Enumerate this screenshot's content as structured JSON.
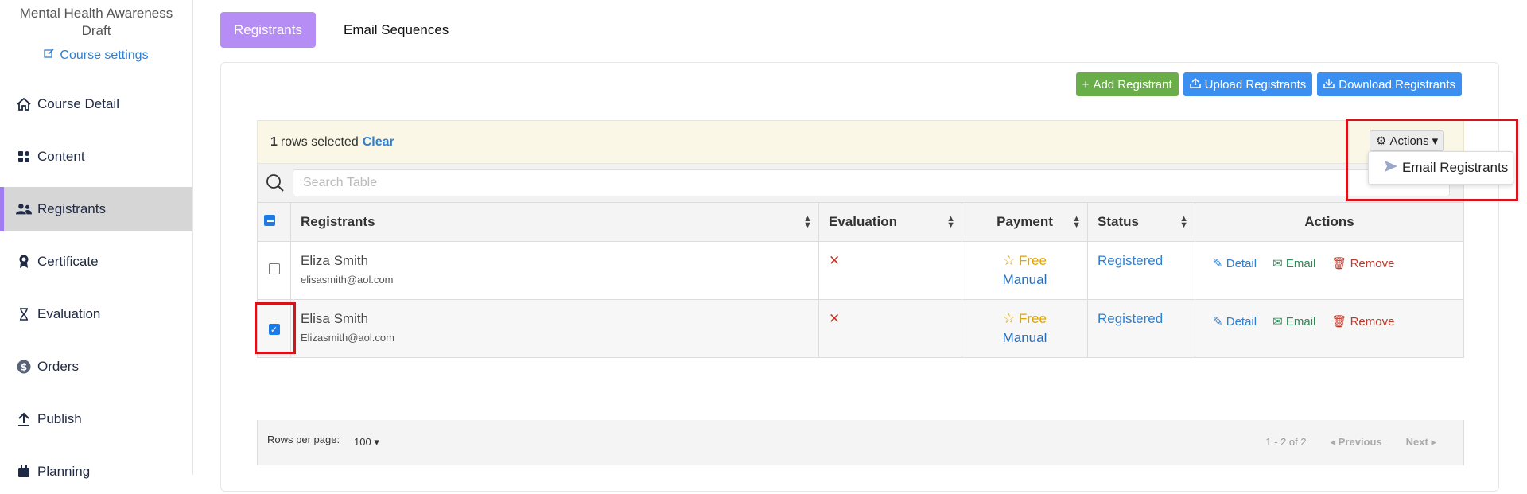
{
  "sidebar": {
    "course_title": "Mental Health Awareness",
    "course_status": "Draft",
    "course_settings": "Course settings",
    "items": [
      {
        "label": "Course Detail",
        "icon": "home-icon"
      },
      {
        "label": "Content",
        "icon": "grid-icon"
      },
      {
        "label": "Registrants",
        "icon": "users-icon"
      },
      {
        "label": "Certificate",
        "icon": "award-icon"
      },
      {
        "label": "Evaluation",
        "icon": "hourglass-icon"
      },
      {
        "label": "Orders",
        "icon": "dollar-circle-icon"
      },
      {
        "label": "Publish",
        "icon": "upload-icon"
      },
      {
        "label": "Planning",
        "icon": "calendar-icon"
      }
    ]
  },
  "tabs": {
    "registrants": "Registrants",
    "email_sequences": "Email Sequences"
  },
  "toolbar": {
    "add": "Add Registrant",
    "upload": "Upload Registrants",
    "download": "Download Registrants"
  },
  "selection": {
    "count": "1",
    "text": "rows selected",
    "clear": "Clear"
  },
  "actions_menu": {
    "button": "Actions",
    "item": "Email Registrants"
  },
  "search": {
    "placeholder": "Search Table"
  },
  "table": {
    "headers": {
      "registrants": "Registrants",
      "evaluation": "Evaluation",
      "payment": "Payment",
      "status": "Status",
      "actions": "Actions"
    },
    "rows": [
      {
        "name": "Eliza Smith",
        "email": "elisasmith@aol.com",
        "evaluation": "✕",
        "payment_type": "Free",
        "payment_method": "Manual",
        "status": "Registered",
        "detail": "Detail",
        "email_action": "Email",
        "remove": "Remove",
        "checked": false
      },
      {
        "name": "Elisa Smith",
        "email": "Elizasmith@aol.com",
        "evaluation": "✕",
        "payment_type": "Free",
        "payment_method": "Manual",
        "status": "Registered",
        "detail": "Detail",
        "email_action": "Email",
        "remove": "Remove",
        "checked": true
      }
    ]
  },
  "footer": {
    "rows_per_page_label": "Rows per page:",
    "rows_per_page_value": "100",
    "range": "1 - 2 of 2",
    "previous": "Previous",
    "next": "Next"
  },
  "colors": {
    "accent": "#b68cf5",
    "primary_blue": "#3b8ff0",
    "success_green": "#6aae4a",
    "highlight_red": "#d6121b"
  }
}
